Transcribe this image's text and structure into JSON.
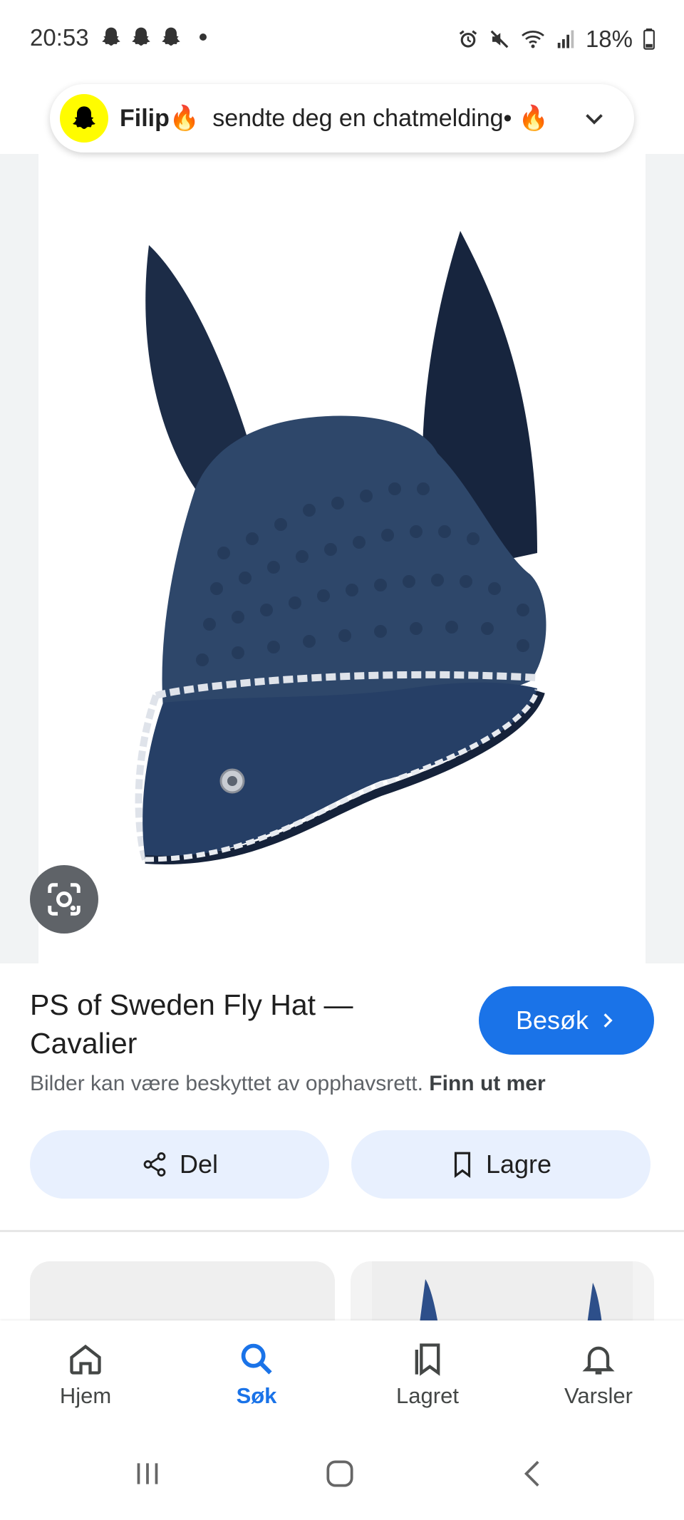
{
  "status_bar": {
    "time": "20:53",
    "battery": "18%",
    "icons": [
      "snapchat-ghost-icon",
      "snapchat-ghost-icon",
      "snapchat-ghost-icon",
      "dot",
      "alarm-icon",
      "mute-icon",
      "wifi-icon",
      "signal-icon",
      "battery-icon"
    ]
  },
  "notification": {
    "app_icon": "snapchat-icon",
    "sender": "Filip🔥",
    "message": "sendte deg en chatmelding• 🔥"
  },
  "product": {
    "title": "PS of Sweden Fly Hat — Cavalier",
    "visit_label": "Besøk",
    "copyright_text": "Bilder kan være beskyttet av opphavsrett.",
    "copyright_link": "Finn ut mer",
    "share_label": "Del",
    "save_label": "Lagre"
  },
  "bottom_nav": {
    "items": [
      {
        "label": "Hjem",
        "icon": "home-icon",
        "active": false
      },
      {
        "label": "Søk",
        "icon": "search-icon",
        "active": true
      },
      {
        "label": "Lagret",
        "icon": "saved-icon",
        "active": false
      },
      {
        "label": "Varsler",
        "icon": "bell-icon",
        "active": false
      }
    ]
  },
  "colors": {
    "accent": "#1a73e8",
    "chip_bg": "#e8f0fe",
    "product_navy": "#1f3351",
    "snapchat_yellow": "#fffc00"
  }
}
